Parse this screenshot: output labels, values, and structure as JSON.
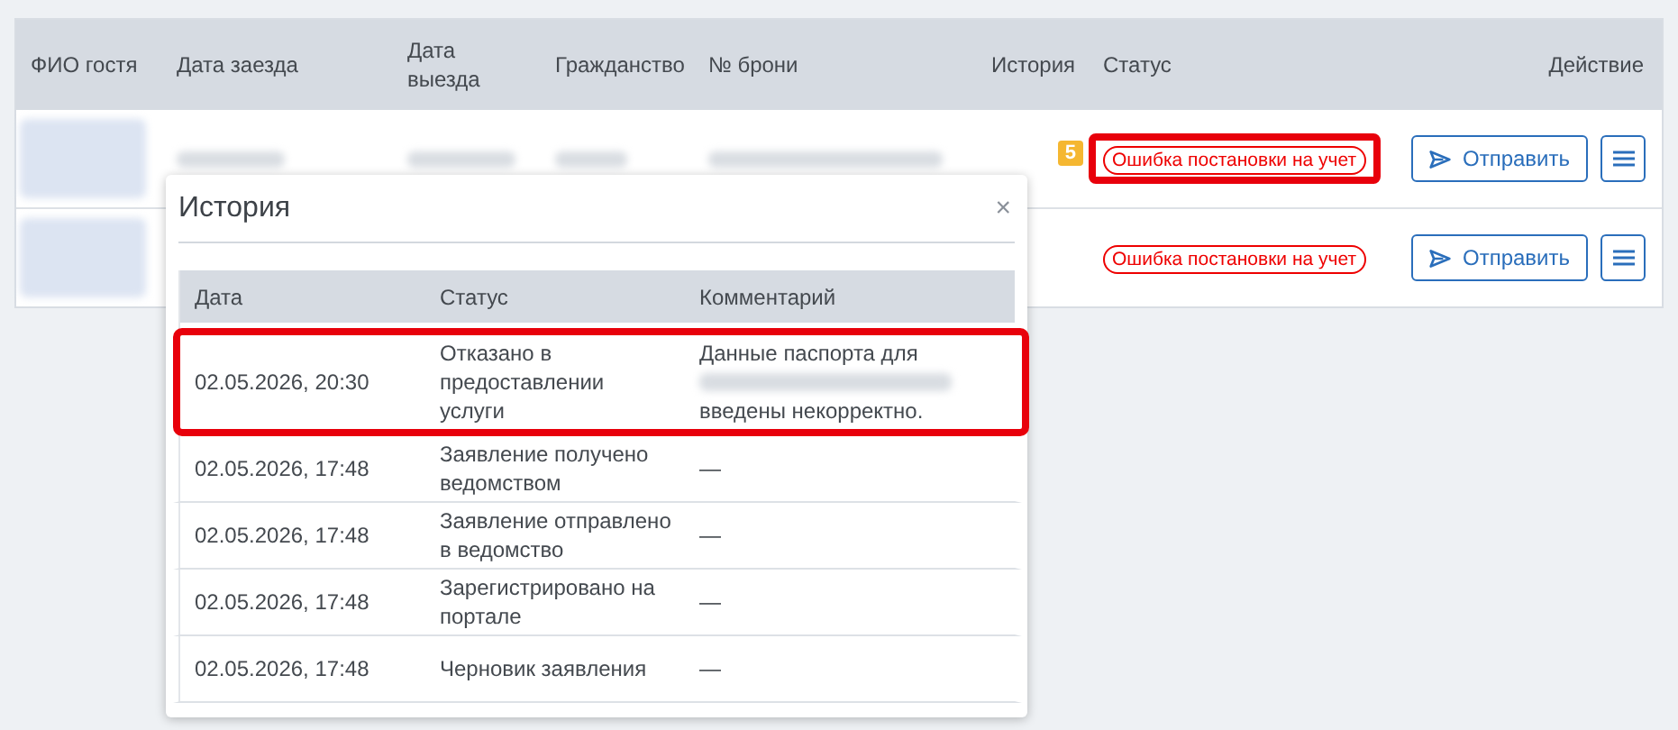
{
  "table": {
    "columns": [
      "ФИО гостя",
      "Дата заезда",
      "Дата выезда",
      "Гражданство",
      "№ брони",
      "История",
      "Статус",
      "Действие"
    ],
    "rows": [
      {
        "history_count": "5",
        "status": {
          "text": "Ошибка постановки на учет",
          "highlighted": true
        },
        "send_button": "Отправить"
      },
      {
        "status": {
          "text": "Ошибка постановки на учет",
          "highlighted": false
        },
        "send_button": "Отправить"
      }
    ]
  },
  "history_popup": {
    "title": "История",
    "close": "×",
    "columns": [
      "Дата",
      "Статус",
      "Комментарий"
    ],
    "rows": [
      {
        "date": "02.05.2026, 20:30",
        "status": "Отказано в предоставлении услуги",
        "comment_before": "Данные паспорта для",
        "comment_after": "введены некорректно.",
        "highlighted": true
      },
      {
        "date": "02.05.2026, 17:48",
        "status": "Заявление получено ведомством",
        "comment": "—",
        "highlighted": false
      },
      {
        "date": "02.05.2026, 17:48",
        "status": "Заявление отправлено в ведомство",
        "comment": "—",
        "highlighted": false
      },
      {
        "date": "02.05.2026, 17:48",
        "status": "Зарегистрировано на портале",
        "comment": "—",
        "highlighted": false
      },
      {
        "date": "02.05.2026, 17:48",
        "status": "Черновик заявления",
        "comment": "—",
        "highlighted": false
      }
    ]
  }
}
